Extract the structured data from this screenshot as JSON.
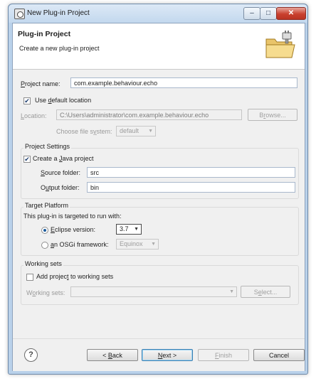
{
  "window": {
    "title": "New Plug-in Project"
  },
  "controls": {
    "minimize": "–",
    "maximize": "□",
    "close": "✕"
  },
  "header": {
    "title": "Plug-in Project",
    "description": "Create a new plug-in project",
    "icon": "plug-in-folder-icon"
  },
  "project": {
    "name_label_prefix": "P",
    "name_label_rest": "roject name:",
    "name_value": "com.example.behaviour.echo",
    "use_default_label_pre": "Use ",
    "use_default_label_u": "d",
    "use_default_label_post": "efault location",
    "use_default_checked": true,
    "location_label_prefix": "L",
    "location_label_rest": "ocation:",
    "location_value": "C:\\Users\\administrator\\com.example.behaviour.echo",
    "browse_pre": "B",
    "browse_u": "r",
    "browse_post": "owse...",
    "fs_label_pre": "Choose file s",
    "fs_label_u": "y",
    "fs_label_post": "stem:",
    "fs_value": "default"
  },
  "project_settings": {
    "title": "Project Settings",
    "create_java_pre": "Create a ",
    "create_java_u": "J",
    "create_java_post": "ava project",
    "create_java_checked": true,
    "source_label_u": "S",
    "source_label_rest": "ource folder:",
    "source_value": "src",
    "output_label_pre": "O",
    "output_label_u": "u",
    "output_label_post": "tput folder:",
    "output_value": "bin"
  },
  "target_platform": {
    "title": "Target Platform",
    "description": "This plug-in is targeted to run with:",
    "eclipse_u": "E",
    "eclipse_rest": "clipse version:",
    "eclipse_selected": true,
    "eclipse_version": "3.7",
    "osgi_u": "a",
    "osgi_rest": "n OSGi framework:",
    "osgi_value": "Equinox"
  },
  "working_sets": {
    "title": "Working sets",
    "add_pre": "Add projec",
    "add_u": "t",
    "add_post": " to working sets",
    "add_checked": false,
    "sets_label_pre": "W",
    "sets_label_u": "o",
    "sets_label_post": "rking sets:",
    "sets_value": "",
    "select_pre": "S",
    "select_u": "e",
    "select_post": "lect..."
  },
  "footer": {
    "help": "?",
    "back_pre": "< ",
    "back_u": "B",
    "back_post": "ack",
    "next_u": "N",
    "next_post": "ext >",
    "finish_u": "F",
    "finish_post": "inish",
    "cancel": "Cancel"
  }
}
